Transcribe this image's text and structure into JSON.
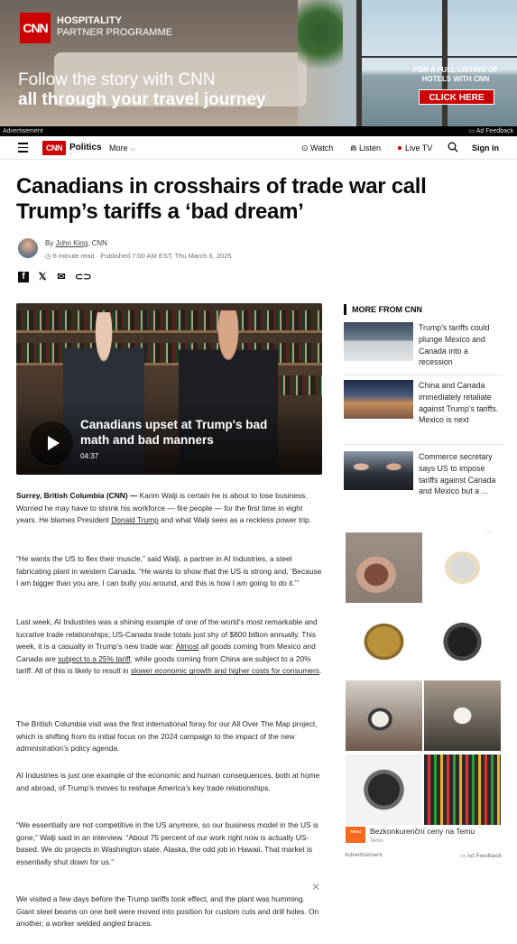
{
  "banner_ad": {
    "logo": "CNN",
    "programme_line1": "HOSPITALITY",
    "programme_line2": "PARTNER PROGRAMME",
    "headline1": "Follow the story with CNN",
    "headline2": "all through your travel journey",
    "side_text": "FOR A FULL LISTING OF HOTELS WITH CNN",
    "cta": "CLICK HERE",
    "advertisement_label": "Advertisement",
    "feedback_label": "Ad Feedback"
  },
  "nav": {
    "logo": "CNN",
    "section": "Politics",
    "more": "More",
    "watch": "Watch",
    "listen": "Listen",
    "live_tv": "Live TV",
    "sign_in": "Sign in"
  },
  "article": {
    "title": "Canadians in crosshairs of trade war call Trump’s tariffs a ‘bad dream’",
    "byline_prefix": "By ",
    "author": "John King",
    "byline_suffix": ", CNN",
    "read_time": "6 minute read",
    "published": "Published 7:00 AM EST, Thu March 6, 2025",
    "video": {
      "title": "Canadians upset at Trump's bad math and bad manners",
      "duration": "04:37"
    },
    "p1": {
      "dateline": "Surrey, British Columbia (CNN) —",
      "text_a": " Karim Walji is certain he is about to lose business. Worried he may have to shrink his workforce — fire people — for the first time in eight years. He blames President ",
      "link": "Donald Trump",
      "text_b": " and what Walji sees as a reckless power trip."
    },
    "p2": "“He wants the US to flex their muscle,” said Walji, a partner in AI Industries, a steel fabricating plant in western Canada. “He wants to show that the US is strong and, ‘Because I am bigger than you are, I can bully you around, and this is how I am going to do it.’”",
    "p3": {
      "text_a": "Last week, AI Industries was a shining example of one of the world’s most remarkable and lucrative trade relationships; US-Canada trade totals just shy of $800 billion annually. This week, it is a casualty in Trump’s new trade war: ",
      "link1": "Almost",
      "text_b": " all goods coming from Mexico and Canada are ",
      "link2": "subject to a 25% tariff",
      "text_c": ", while goods coming from China are subject to a 20% tariff. All of this is likely to result in ",
      "link3": "slower economic growth and higher costs for consumers",
      "text_d": "."
    },
    "p4": "The British Columbia visit was the first international foray for our All Over The Map project, which is shifting from its initial focus on the 2024 campaign to the impact of the new administration’s policy agenda.",
    "p5": "AI Industries is just one example of the economic and human consequences, both at home and abroad, of Trump’s moves to reshape America’s key trade relationships.",
    "p6": "“We essentially are not competitive in the US anymore, so our business model in the US is gone,” Walji said in an interview. “About 75 percent of our work right now is actually US-based. We do projects in Washington state, Alaska, the odd job in Hawaii. That market is essentially shut down for us.”",
    "p7": "We visited a few days before the Trump tariffs took effect, and the plant was humming. Giant steel beams on one belt were moved into position for custom cuts and drill holes. On another, a worker welded angled braces."
  },
  "more_from_cnn": {
    "heading": "MORE FROM CNN",
    "items": [
      {
        "text": "Trump’s tariffs could plunge Mexico and Canada into a recession"
      },
      {
        "text": "China and Canada immediately retaliate against Trump’s tariffs. Mexico is next"
      },
      {
        "text": "Commerce secretary says US to impose tariffs against Canada and Mexico but a ..."
      }
    ]
  },
  "side_ad": {
    "adchoices": "ⓘ ✕",
    "advertiser_logo": "Temu",
    "advertiser_text": "Bezkonkurenční ceny na Temu",
    "advertiser_sub": "Temu",
    "advertisement_label": "Advertisement",
    "feedback_label": "Ad Feedback"
  },
  "close_symbol": "✕"
}
